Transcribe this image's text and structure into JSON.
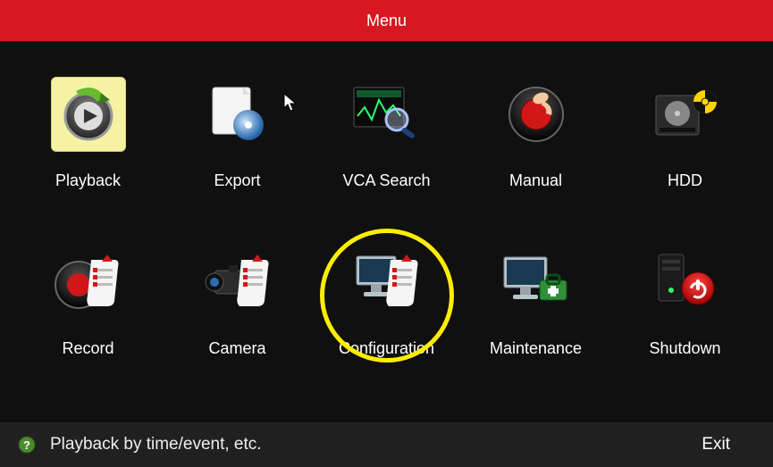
{
  "title": "Menu",
  "items": [
    {
      "label": "Playback",
      "icon": "playback-icon",
      "selected": true
    },
    {
      "label": "Export",
      "icon": "export-icon",
      "selected": false
    },
    {
      "label": "VCA Search",
      "icon": "vca-search-icon",
      "selected": false
    },
    {
      "label": "Manual",
      "icon": "manual-icon",
      "selected": false
    },
    {
      "label": "HDD",
      "icon": "hdd-icon",
      "selected": false
    },
    {
      "label": "Record",
      "icon": "record-icon",
      "selected": false
    },
    {
      "label": "Camera",
      "icon": "camera-icon",
      "selected": false
    },
    {
      "label": "Configuration",
      "icon": "configuration-icon",
      "selected": false,
      "highlighted": true
    },
    {
      "label": "Maintenance",
      "icon": "maintenance-icon",
      "selected": false
    },
    {
      "label": "Shutdown",
      "icon": "shutdown-icon",
      "selected": false
    }
  ],
  "status_hint": "Playback by time/event, etc.",
  "exit_label": "Exit",
  "colors": {
    "accent": "#d71820",
    "highlight": "#ffed00"
  }
}
